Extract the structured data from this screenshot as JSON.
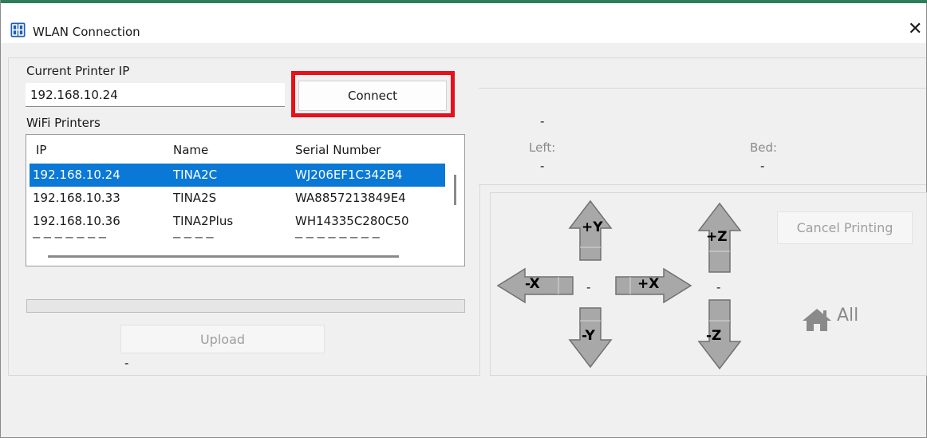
{
  "window": {
    "title": "WLAN Connection",
    "close_icon": "close-icon",
    "app_icon": "printer-app-icon"
  },
  "connection": {
    "current_ip_label": "Current Printer IP",
    "ip_value": "192.168.10.24",
    "connect_label": "Connect",
    "wifi_printers_label": "WiFi Printers"
  },
  "printers": {
    "columns": [
      "IP",
      "Name",
      "Serial Number"
    ],
    "rows": [
      {
        "ip": "192.168.10.24",
        "name": "TINA2C",
        "serial": "WJ206EF1C342B4",
        "selected": true
      },
      {
        "ip": "192.168.10.33",
        "name": "TINA2S",
        "serial": "WA8857213849E4",
        "selected": false
      },
      {
        "ip": "192.168.10.36",
        "name": "TINA2Plus",
        "serial": "WH14335C280C50",
        "selected": false
      }
    ]
  },
  "upload": {
    "label": "Upload",
    "status": "-"
  },
  "temps": {
    "status": "-",
    "left_label": "Left:",
    "left_value": "-",
    "bed_label": "Bed:",
    "bed_value": "-"
  },
  "control": {
    "cancel_label": "Cancel Printing",
    "y_plus": "+Y",
    "y_minus": "-Y",
    "x_plus": "+X",
    "x_minus": "-X",
    "z_plus": "+Z",
    "z_minus": "-Z",
    "xy_value": "-",
    "z_value": "-",
    "home_label": "All",
    "home_icon": "home-icon"
  },
  "colors": {
    "selection": "#0a78d6",
    "highlight_box": "#e8101a",
    "arrow_fill": "#a8a8a8"
  }
}
